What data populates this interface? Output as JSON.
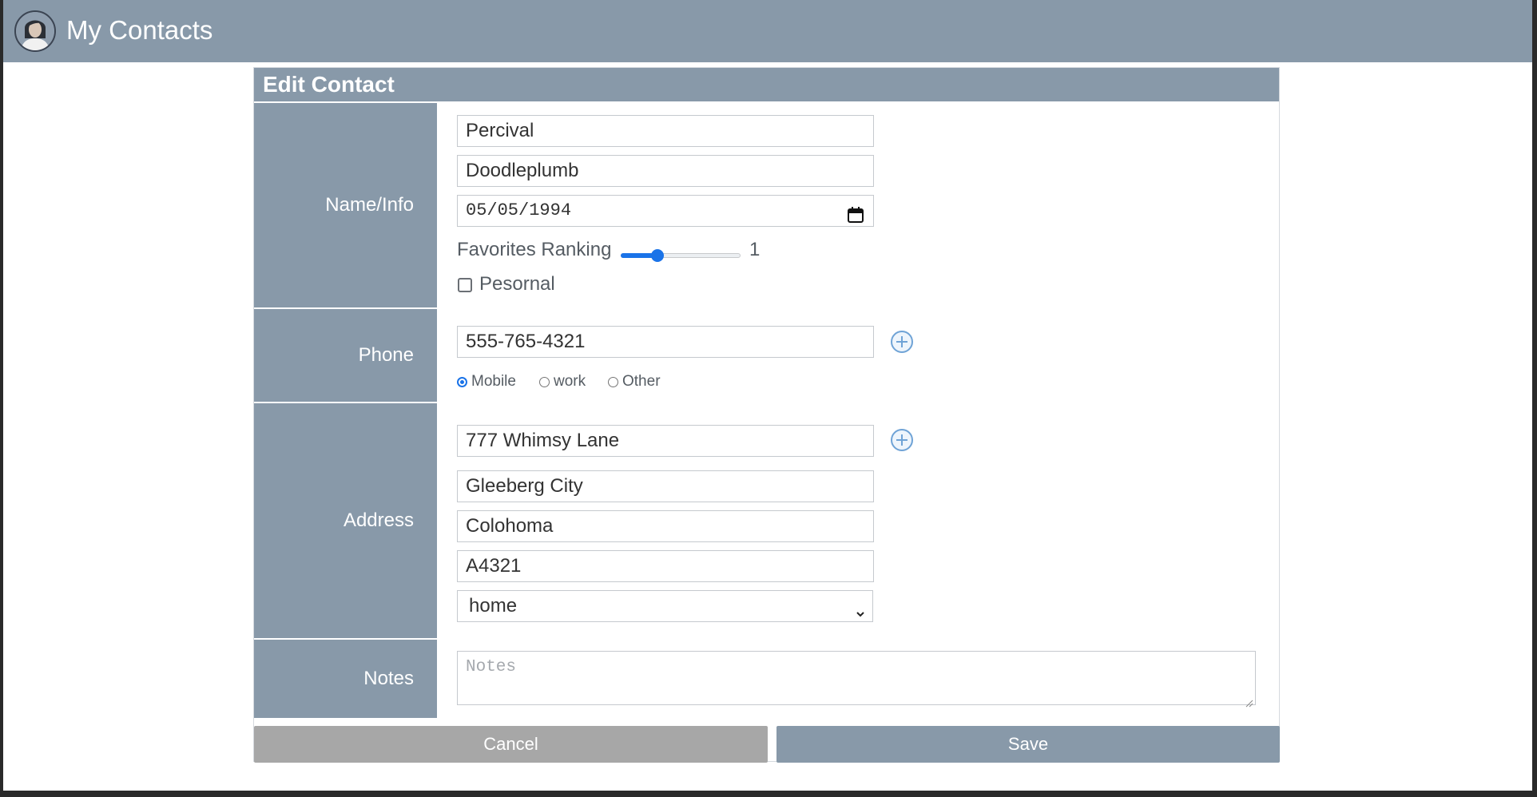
{
  "app": {
    "title": "My Contacts"
  },
  "form": {
    "title": "Edit Contact",
    "sections": {
      "name_info": "Name/Info",
      "phone": "Phone",
      "address": "Address",
      "notes": "Notes"
    },
    "first_name": "Percival",
    "last_name": "Doodleplumb",
    "birthdate": "05/05/1994",
    "favorites_label": "Favorites Ranking",
    "favorites_value": "1",
    "favorites_fraction": 0.28,
    "personal_label": "Pesornal",
    "personal_checked": false,
    "phone_number": "555-765-4321",
    "phone_types": [
      {
        "label": "Mobile",
        "checked": true
      },
      {
        "label": "work",
        "checked": false
      },
      {
        "label": "Other",
        "checked": false
      }
    ],
    "street": "777 Whimsy Lane",
    "city": "Gleeberg City",
    "state": "Colohoma",
    "zip": "A4321",
    "address_type": "home",
    "notes_placeholder": "Notes",
    "cancel_label": "Cancel",
    "save_label": "Save"
  },
  "colors": {
    "header": "#8899a9",
    "accent": "#1a73e8",
    "cancel": "#a7a7a7"
  },
  "icons": [
    "user-avatar-icon",
    "calendar-icon",
    "add-circle-icon",
    "chevron-down-icon"
  ]
}
